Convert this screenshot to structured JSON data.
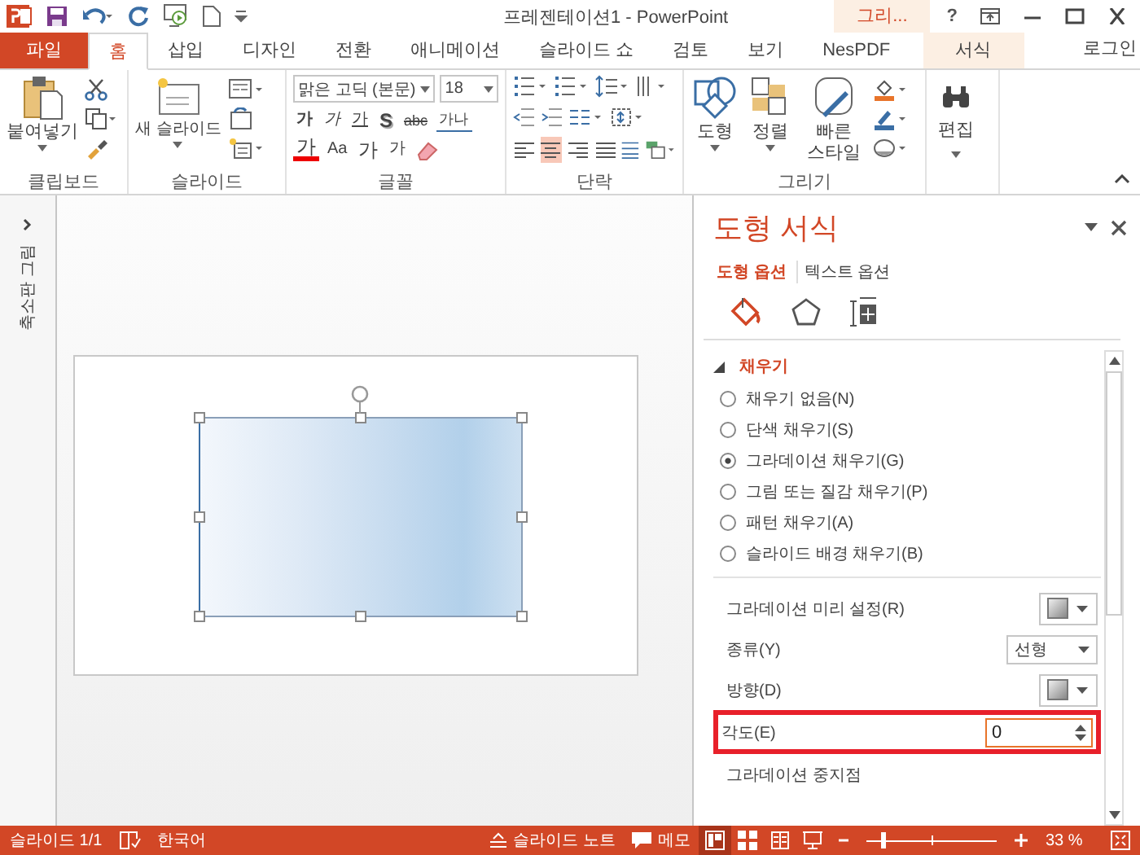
{
  "window": {
    "title": "프레젠테이션1 - PowerPoint",
    "context_group": "그리...",
    "help": "?"
  },
  "tabs": [
    {
      "label": "파일",
      "kind": "file",
      "selected": false
    },
    {
      "label": "홈",
      "kind": "normal",
      "selected": true
    },
    {
      "label": "삽입",
      "kind": "normal",
      "selected": false
    },
    {
      "label": "디자인",
      "kind": "normal",
      "selected": false
    },
    {
      "label": "전환",
      "kind": "normal",
      "selected": false
    },
    {
      "label": "애니메이션",
      "kind": "normal",
      "selected": false
    },
    {
      "label": "슬라이드 쇼",
      "kind": "normal",
      "selected": false
    },
    {
      "label": "검토",
      "kind": "normal",
      "selected": false
    },
    {
      "label": "보기",
      "kind": "normal",
      "selected": false
    },
    {
      "label": "NesPDF",
      "kind": "normal",
      "selected": false
    },
    {
      "label": "서식",
      "kind": "context",
      "selected": false
    }
  ],
  "account": "로그인",
  "ribbon": {
    "clipboard": {
      "label": "클립보드",
      "paste": "붙여넣기"
    },
    "slides": {
      "label": "슬라이드",
      "new_slide": "새 슬라이드"
    },
    "font": {
      "label": "글꼴",
      "font_name": "맑은 고딕 (본문)",
      "font_size": "18",
      "row1": [
        {
          "label": "가",
          "kind": "bold"
        },
        {
          "label": "가",
          "kind": "italic"
        },
        {
          "label": "가",
          "kind": "underline"
        },
        {
          "label": "S",
          "kind": "shadow"
        },
        {
          "label": "abc",
          "kind": "strike"
        },
        {
          "label": "가나",
          "kind": "spacing"
        }
      ],
      "row2": [
        {
          "label": "가",
          "kind": "color"
        },
        {
          "label": "Aa",
          "kind": "case"
        },
        {
          "label": "가",
          "kind": "grow"
        },
        {
          "label": "가",
          "kind": "shrink"
        }
      ]
    },
    "paragraph": {
      "label": "단락",
      "alignments": [
        {
          "kind": "left",
          "selected": false
        },
        {
          "kind": "center",
          "selected": true
        },
        {
          "kind": "right",
          "selected": false
        },
        {
          "kind": "justify",
          "selected": false
        }
      ]
    },
    "drawing": {
      "label": "그리기",
      "shapes": "도형",
      "arrange": "정렬",
      "quick_styles": "빠른 스타일"
    },
    "editing": {
      "button": "편집"
    }
  },
  "thumbnails": {
    "label": "축소판 그림"
  },
  "slide": {
    "shape_selected": true
  },
  "format_pane": {
    "title": "도형 서식",
    "option_tabs": [
      {
        "label": "도형 옵션",
        "selected": true
      },
      {
        "label": "텍스트 옵션",
        "selected": false
      }
    ],
    "icon_tabs": [
      {
        "kind": "fill",
        "selected": true
      },
      {
        "kind": "effects",
        "selected": false
      },
      {
        "kind": "size",
        "selected": false
      }
    ],
    "section": {
      "title": "채우기",
      "expanded": true
    },
    "fill_options": [
      {
        "label": "채우기 없음(N)",
        "selected": false
      },
      {
        "label": "단색 채우기(S)",
        "selected": false
      },
      {
        "label": "그라데이션 채우기(G)",
        "selected": true
      },
      {
        "label": "그림 또는 질감 채우기(P)",
        "selected": false
      },
      {
        "label": "패턴 채우기(A)",
        "selected": false
      },
      {
        "label": "슬라이드 배경 채우기(B)",
        "selected": false
      }
    ],
    "settings": [
      {
        "label": "그라데이션 미리 설정(R)",
        "kind": "swatch",
        "highlighted": false
      },
      {
        "label": "종류(Y)",
        "kind": "dropdown",
        "value": "선형",
        "highlighted": false
      },
      {
        "label": "방향(D)",
        "kind": "swatch",
        "highlighted": false
      },
      {
        "label": "각도(E)",
        "kind": "spinner",
        "value": "0",
        "highlighted": true
      },
      {
        "label": "그라데이션 중지점",
        "kind": "heading",
        "highlighted": false
      }
    ]
  },
  "status_bar": {
    "slide": "슬라이드 1/1",
    "language": "한국어",
    "notes": "슬라이드 노트",
    "comments": "메모",
    "views": [
      {
        "kind": "normal",
        "selected": true
      },
      {
        "kind": "sorter",
        "selected": false
      },
      {
        "kind": "reading",
        "selected": false
      },
      {
        "kind": "slideshow",
        "selected": false
      }
    ],
    "zoom_slider": {
      "level": 0.12
    },
    "zoom": "33 %"
  }
}
